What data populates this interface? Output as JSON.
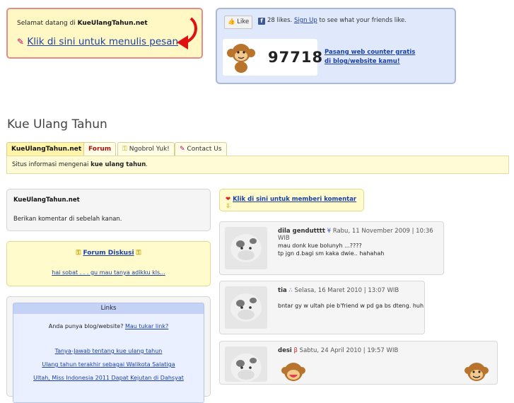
{
  "welcome": {
    "prefix": "Selamat datang di ",
    "site": "KueUlangTahun.net",
    "link": "Klik di sini untuk menulis pesan"
  },
  "counter": {
    "like_label": "Like",
    "likes_text": "28 likes.",
    "signup": "Sign Up",
    "signup_suffix": " to see what your friends like.",
    "count": "97718",
    "pasang_line1": "Pasang web counter gratis",
    "pasang_line2": "di blog/website kamu!"
  },
  "page_title": "Kue Ulang Tahun",
  "tabs": [
    {
      "label": "KueUlangTahun.net",
      "icon": ""
    },
    {
      "label": "Forum",
      "icon": ""
    },
    {
      "label": "Ngobrol Yuk!",
      "icon": "key-icon"
    },
    {
      "label": "Contact Us",
      "icon": "pencil-icon"
    }
  ],
  "tabbar": {
    "prefix": "Situs informasi mengenai ",
    "bold": "kue ulang tahun",
    "suffix": "."
  },
  "left": {
    "box1_title": "KueUlangTahun.net",
    "box1_text": "Berikan komentar di sebelah kanan.",
    "forum_title": "Forum Diskusi",
    "forum_text": "hai sobat . . . gu mau tanya adikku kls...",
    "links_header": "Links",
    "links_question": "Anda punya blog/website?",
    "links_question_link": "Mau tukar link?",
    "links": [
      "Tanya-Jawab tentang kue ulang tahun",
      "Ulang tahun terakhir sebagai Walikota Salatiga",
      "Ultah, Miss Indonesia 2011 Dapat Kejutan di Dahsyat"
    ]
  },
  "comment_button": "Klik di sini untuk memberi komentar",
  "comments": [
    {
      "name": "dila gendutttt",
      "symbol": "¥",
      "date": "Rabu, 11 November 2009 | 10:36 WIB",
      "lines": [
        "mau donk kue bolunyh ...????",
        "tp jgn d.bagi sm kaka dwie.. hahahah"
      ]
    },
    {
      "name": "tia",
      "symbol": "∴",
      "date": "Selasa, 16 Maret 2010 | 13:07 WIB",
      "lines": [
        "bntar gy w ultah pie b'friend w pd ga bs dteng. huh"
      ]
    },
    {
      "name": "desi",
      "symbol": "β",
      "date": "Sabtu, 24 April 2010 | 19:57 WIB",
      "lines": []
    }
  ],
  "colors": {
    "link": "#1a3faa",
    "welcome_border": "#e78a8a",
    "counter_bg": "#dfe9fb",
    "yellow_box": "#fffbcc"
  }
}
